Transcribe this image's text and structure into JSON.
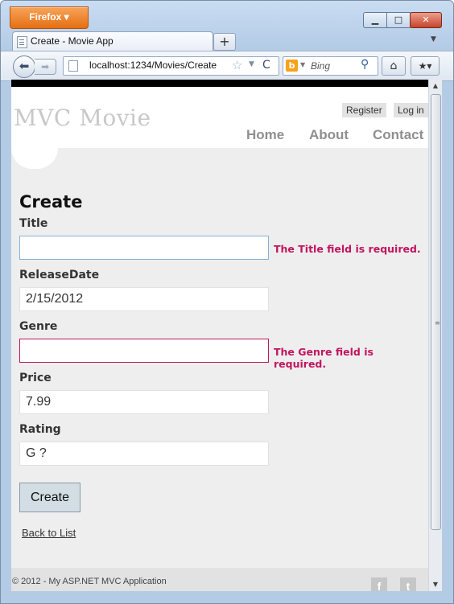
{
  "browser": {
    "menu_button": "Firefox",
    "menu_arrow": "▾",
    "window_controls": {
      "minimize": "▁",
      "maximize": "□",
      "close": "✕"
    },
    "tab": {
      "title": "Create - Movie App"
    },
    "new_tab": "+",
    "tab_list_arrow": "▼",
    "nav": {
      "back": "⬅",
      "forward": "➡"
    },
    "address": {
      "url": "localhost:1234/Movies/Create",
      "bookmark_star": "☆",
      "dropdown": "▼",
      "reload": "C"
    },
    "search": {
      "engine_letter": "b",
      "engine_dropdown": "▼",
      "placeholder": "Bing",
      "go": "⚲"
    },
    "home": "⌂",
    "bookmarks": "★▾",
    "scrollbar": {
      "up": "▲",
      "down": "▼",
      "grip": "≡"
    }
  },
  "site": {
    "title": "MVC Movie",
    "login": {
      "register": "Register",
      "login": "Log in"
    },
    "menu": {
      "home": "Home",
      "about": "About",
      "contact": "Contact"
    },
    "footer": {
      "copyright": "© 2012 - My ASP.NET MVC Application",
      "facebook": "f",
      "twitter": "t"
    }
  },
  "form": {
    "heading": "Create",
    "fields": [
      {
        "label": "Title",
        "value": "",
        "error": "The Title field is required."
      },
      {
        "label": "ReleaseDate",
        "value": "2/15/2012",
        "error": ""
      },
      {
        "label": "Genre",
        "value": "",
        "error": "The Genre field is required."
      },
      {
        "label": "Price",
        "value": "7.99",
        "error": ""
      },
      {
        "label": "Rating",
        "value": "G ?",
        "error": ""
      }
    ],
    "submit": "Create",
    "back_link": "Back to List"
  },
  "colors": {
    "error": "#c0155e",
    "page_bg": "#efeeef",
    "firefox_orange": "#e56f12"
  }
}
